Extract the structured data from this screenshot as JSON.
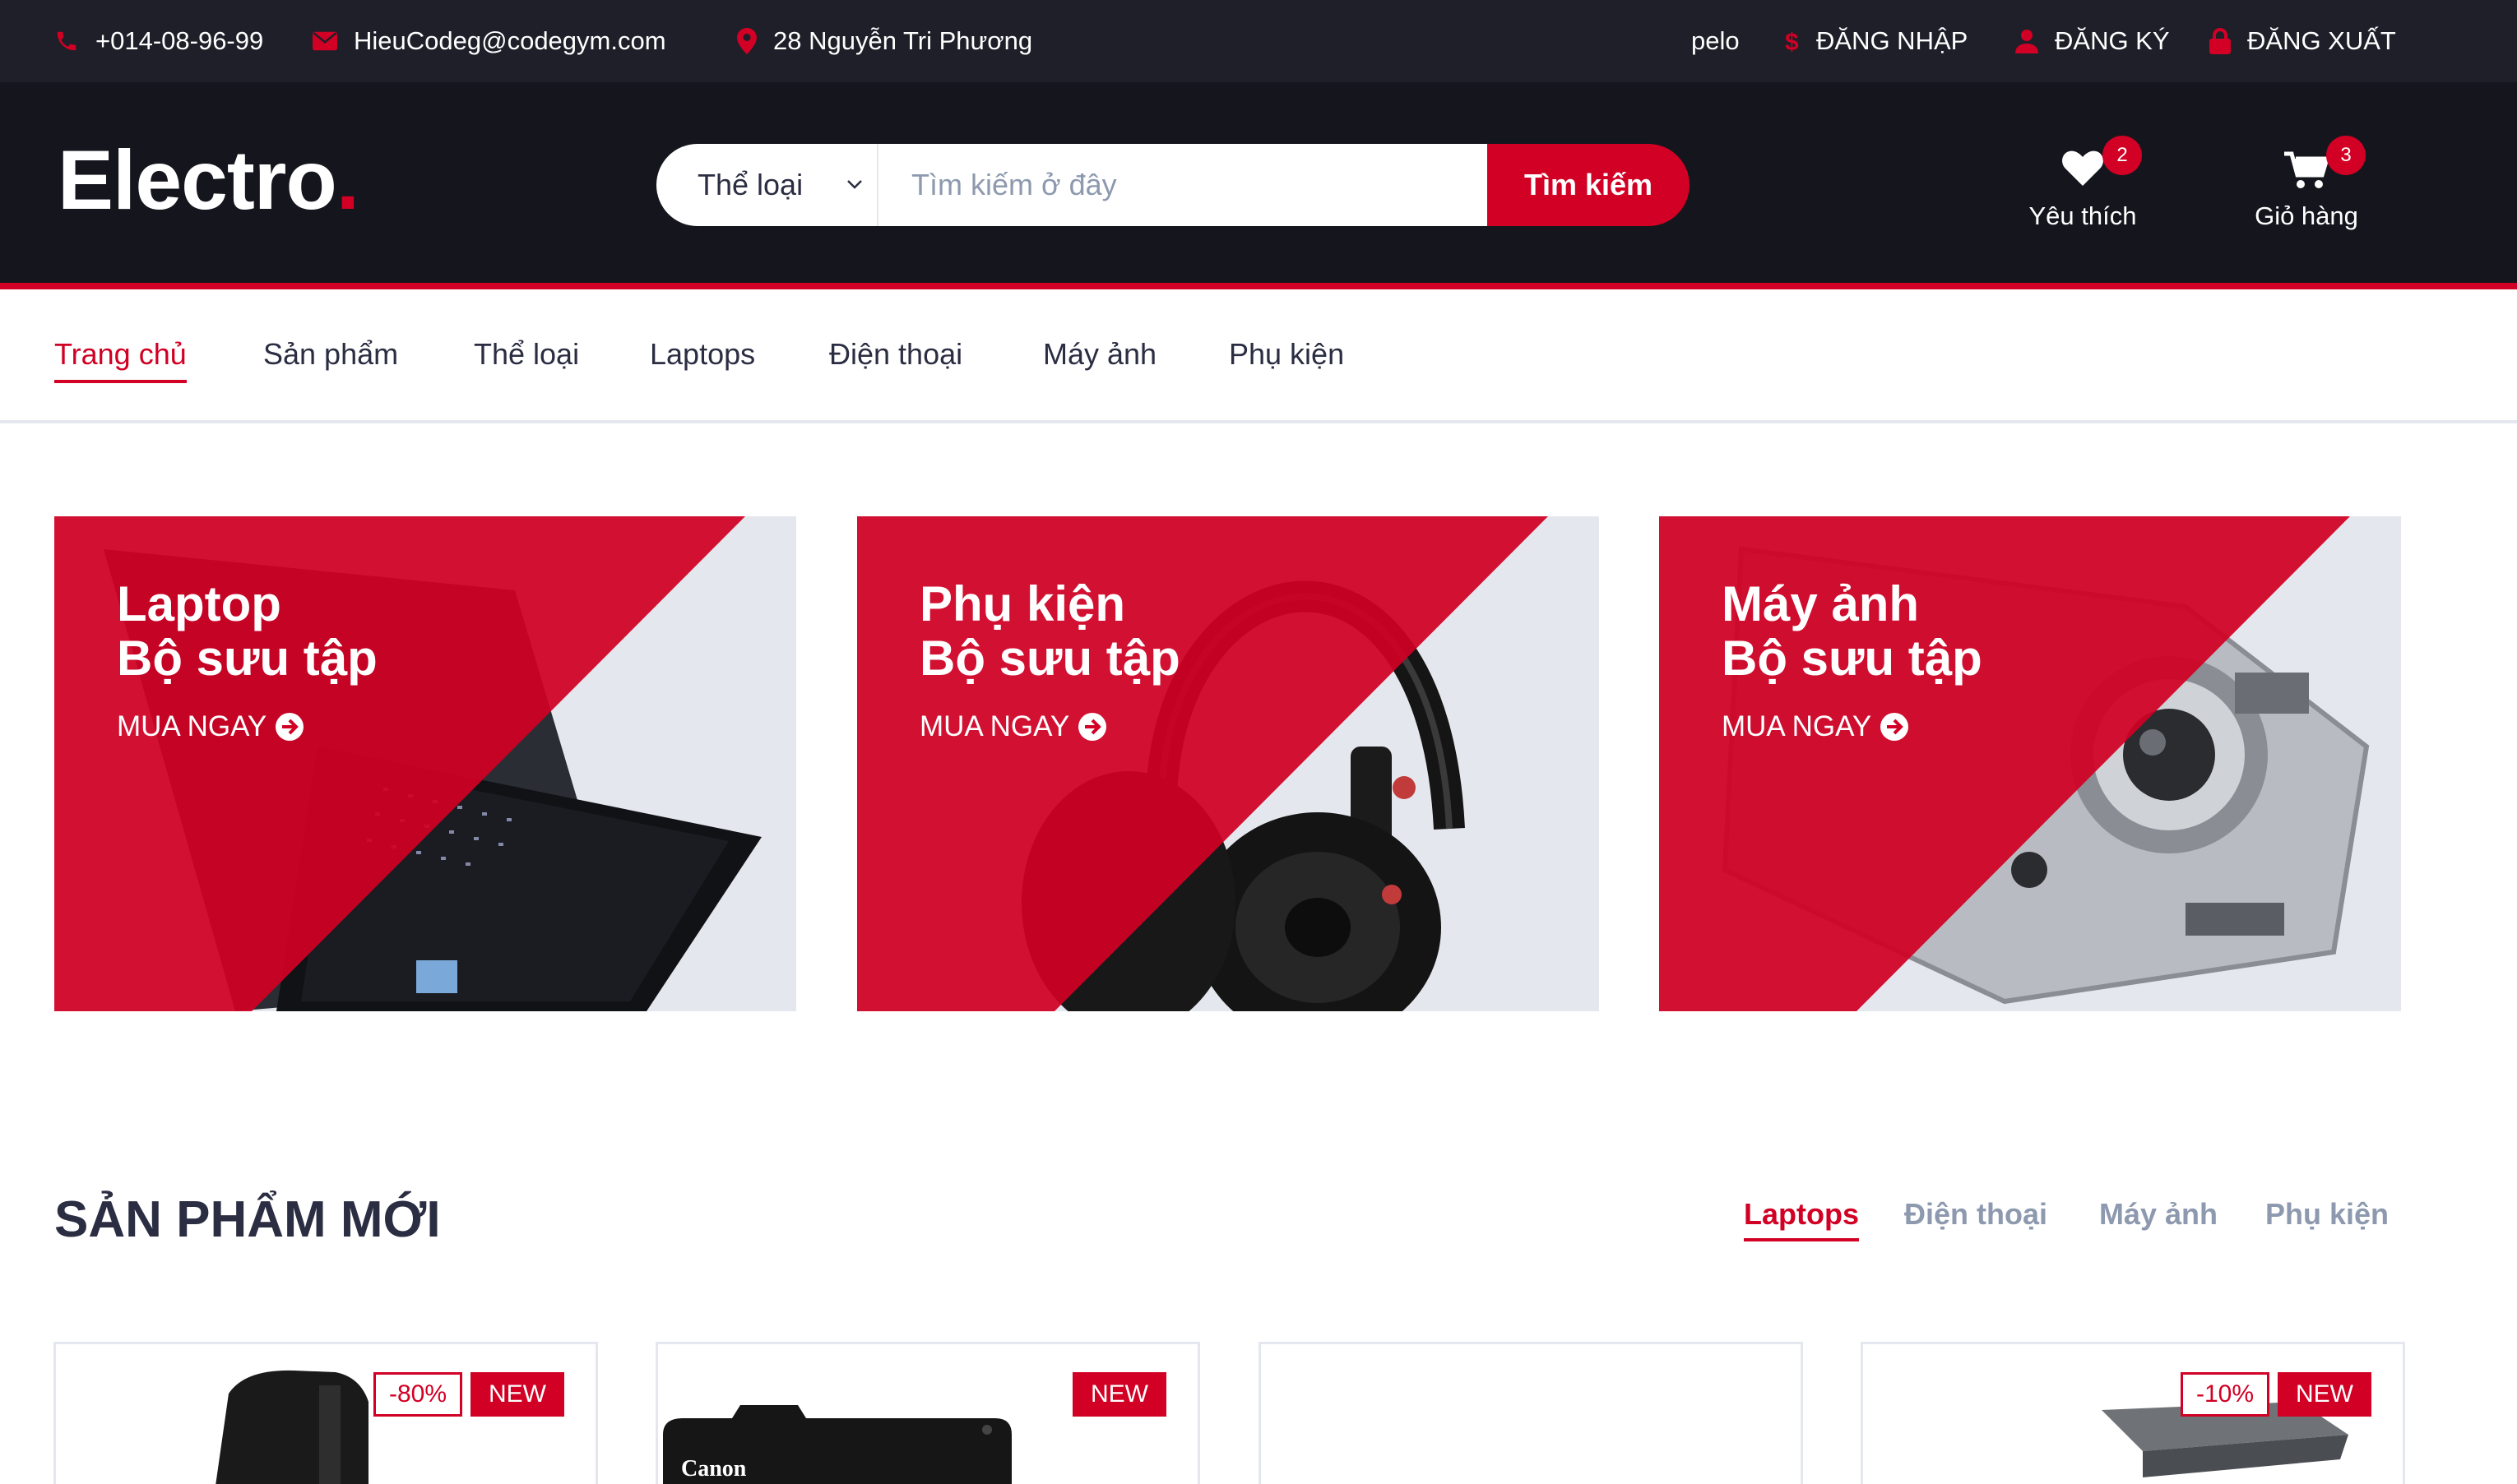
{
  "topbar": {
    "phone": "+014-08-96-99",
    "email": "HieuCodeg@codegym.com",
    "address": "28 Nguyễn Tri Phương",
    "username": "pelo",
    "login": "ĐĂNG NHẬP",
    "register": "ĐĂNG KÝ",
    "logout": "ĐĂNG XUẤT"
  },
  "header": {
    "logo": "Electro",
    "logo_dot": ".",
    "category_select": "Thể loại",
    "search_placeholder": "Tìm kiếm ở đây",
    "search_button": "Tìm kiếm",
    "wishlist_label": "Yêu thích",
    "wishlist_count": "2",
    "cart_label": "Giỏ hàng",
    "cart_count": "3"
  },
  "nav": {
    "items": [
      "Trang chủ",
      "Sản phẩm",
      "Thể loại",
      "Laptops",
      "Điện thoại",
      "Máy ảnh",
      "Phụ kiện"
    ],
    "active_index": 0
  },
  "collections": [
    {
      "name": "Laptop",
      "subtitle": "Bộ sưu tập",
      "cta": "MUA NGAY",
      "image": "laptop"
    },
    {
      "name": "Phụ kiện",
      "subtitle": "Bộ sưu tập",
      "cta": "MUA NGAY",
      "image": "headphones"
    },
    {
      "name": "Máy ảnh",
      "subtitle": "Bộ sưu tập",
      "cta": "MUA NGAY",
      "image": "camera"
    }
  ],
  "new_products": {
    "title": "SẢN PHẨM MỚI",
    "tabs": [
      "Laptops",
      "Điện thoại",
      "Máy ảnh",
      "Phụ kiện"
    ],
    "active_tab": 0,
    "cards": [
      {
        "sale": "-80%",
        "badge": "NEW",
        "image": "desktop-case"
      },
      {
        "sale": "",
        "badge": "NEW",
        "image": "canon-camera"
      },
      {
        "sale": "",
        "badge": "",
        "image": "empty"
      },
      {
        "sale": "-10%",
        "badge": "NEW",
        "image": "laptop"
      }
    ]
  },
  "colors": {
    "primary": "#d10024",
    "dark": "#15161d",
    "topbar": "#1e1f29",
    "text": "#2b2d42",
    "muted": "#8d99ae",
    "border": "#e4e7ed"
  }
}
